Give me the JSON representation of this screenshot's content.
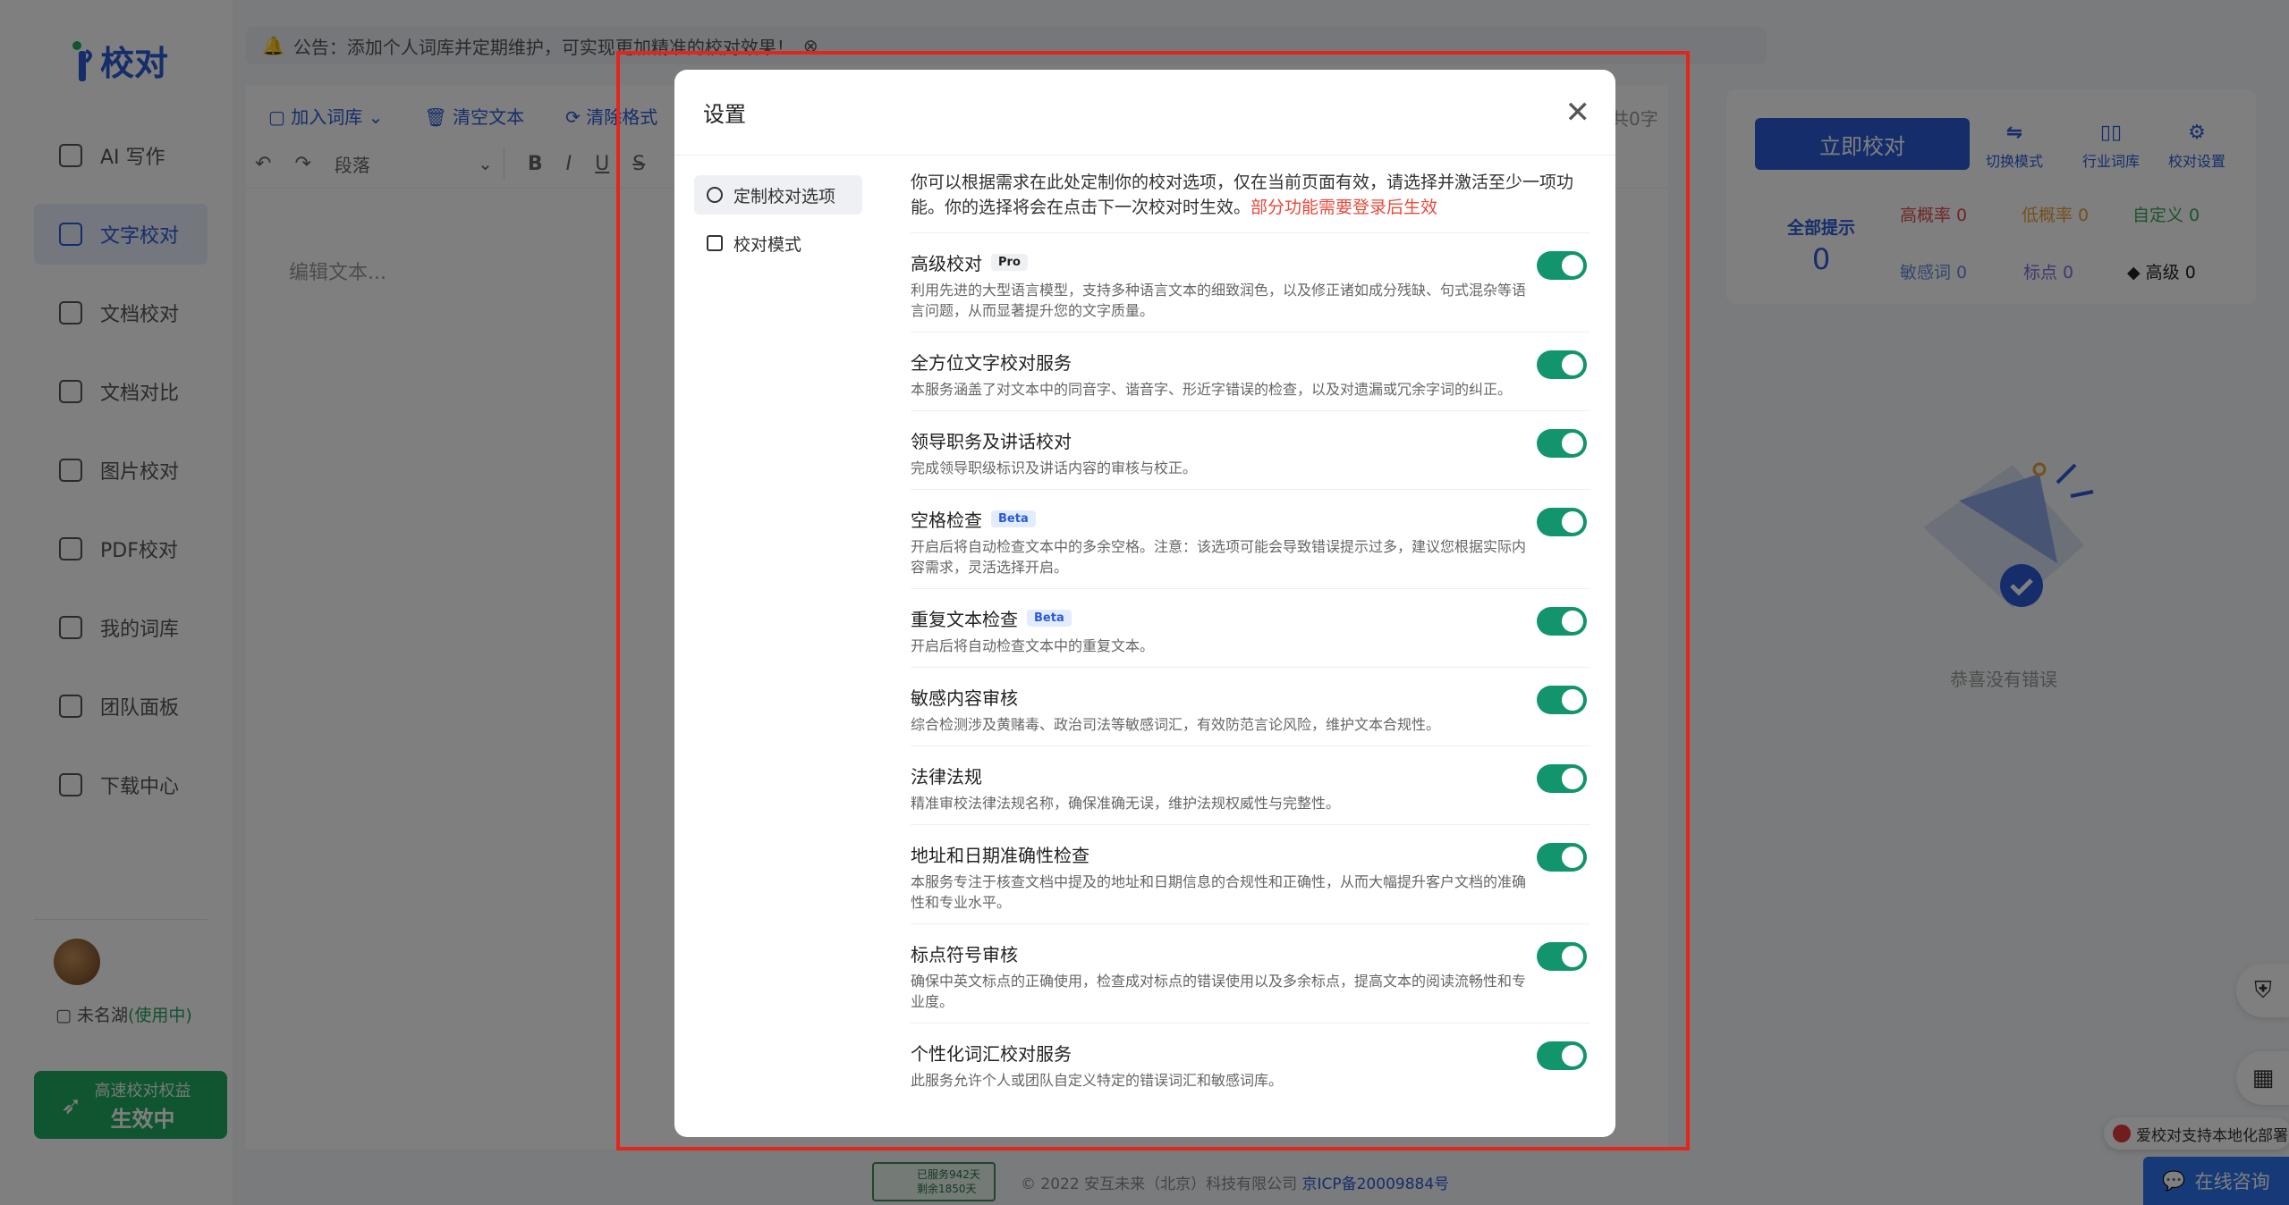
{
  "app": {
    "logo_text": "校对",
    "brand_color": "#2a5bd7",
    "notice": "公告：添加个人词库并定期维护，可实现更加精准的校对效果！"
  },
  "sidebar": {
    "items": [
      {
        "label": "AI 写作",
        "icon": "ai-write-icon"
      },
      {
        "label": "文字校对",
        "icon": "text-proof-icon",
        "active": true
      },
      {
        "label": "文档校对",
        "icon": "doc-proof-icon"
      },
      {
        "label": "文档对比",
        "icon": "doc-compare-icon"
      },
      {
        "label": "图片校对",
        "icon": "image-proof-icon"
      },
      {
        "label": "PDF校对",
        "icon": "pdf-proof-icon"
      },
      {
        "label": "我的词库",
        "icon": "dictionary-icon"
      },
      {
        "label": "团队面板",
        "icon": "team-icon"
      },
      {
        "label": "下载中心",
        "icon": "download-icon"
      }
    ],
    "user_name": "未名湖",
    "user_status": "(使用中)",
    "promo_line1": "高速校对权益",
    "promo_line2": "生效中"
  },
  "editor": {
    "toolbar": {
      "add_dict": "加入词库",
      "clear_text": "清空文本",
      "clear_format": "清除格式"
    },
    "paragraph_select": "段落",
    "word_count": "共0字",
    "placeholder": "编辑文本..."
  },
  "right_panel": {
    "proofread_now": "立即校对",
    "tools": [
      "切换模式",
      "行业词库",
      "校对设置"
    ],
    "stat_all_label": "全部提示",
    "stat_all_value": "0",
    "stats": {
      "high": "高概率 0",
      "low": "低概率 0",
      "custom": "自定义 0",
      "sensitive": "敏感词 0",
      "punct": "标点 0",
      "advanced": "高级 0"
    },
    "empty_text": "恭喜没有错误"
  },
  "floating": {
    "local_tip": "爱校对支持本地化部署",
    "consult": "在线咨询"
  },
  "footer": {
    "badge_line1": "已服务942天",
    "badge_line2": "剩余1850天",
    "copyright": "© 2022 安互未来（北京）科技有限公司",
    "icp": "京ICP备20009884号"
  },
  "modal": {
    "title": "设置",
    "menu": [
      "定制校对选项",
      "校对模式"
    ],
    "intro": "你可以根据需求在此处定制你的校对选项，仅在当前页面有效，请选择并激活至少一项功能。你的选择将会在点击下一次校对时生效。",
    "intro_warning": "部分功能需要登录后生效",
    "toggle_color": "#12946c",
    "options": [
      {
        "title": "高级校对",
        "tag": "Pro",
        "desc": "利用先进的大型语言模型，支持多种语言文本的细致润色，以及修正诸如成分残缺、句式混杂等语言问题，从而显著提升您的文字质量。",
        "on": true
      },
      {
        "title": "全方位文字校对服务",
        "tag": "",
        "desc": "本服务涵盖了对文本中的同音字、谐音字、形近字错误的检查，以及对遗漏或冗余字词的纠正。",
        "on": true
      },
      {
        "title": "领导职务及讲话校对",
        "tag": "",
        "desc": "完成领导职级标识及讲话内容的审核与校正。",
        "on": true
      },
      {
        "title": "空格检查",
        "tag": "Beta",
        "desc": "开启后将自动检查文本中的多余空格。注意：该选项可能会导致错误提示过多，建议您根据实际内容需求，灵活选择开启。",
        "on": true
      },
      {
        "title": "重复文本检查",
        "tag": "Beta",
        "desc": "开启后将自动检查文本中的重复文本。",
        "on": true
      },
      {
        "title": "敏感内容审核",
        "tag": "",
        "desc": "综合检测涉及黄赌毒、政治司法等敏感词汇，有效防范言论风险，维护文本合规性。",
        "on": true
      },
      {
        "title": "法律法规",
        "tag": "",
        "desc": "精准审校法律法规名称，确保准确无误，维护法规权威性与完整性。",
        "on": true
      },
      {
        "title": "地址和日期准确性检查",
        "tag": "",
        "desc": "本服务专注于核查文档中提及的地址和日期信息的合规性和正确性，从而大幅提升客户文档的准确性和专业水平。",
        "on": true
      },
      {
        "title": "标点符号审核",
        "tag": "",
        "desc": "确保中英文标点的正确使用，检查成对标点的错误使用以及多余标点，提高文本的阅读流畅性和专业度。",
        "on": true
      },
      {
        "title": "个性化词汇校对服务",
        "tag": "",
        "desc": "此服务允许个人或团队自定义特定的错误词汇和敏感词库。",
        "on": true
      }
    ]
  }
}
